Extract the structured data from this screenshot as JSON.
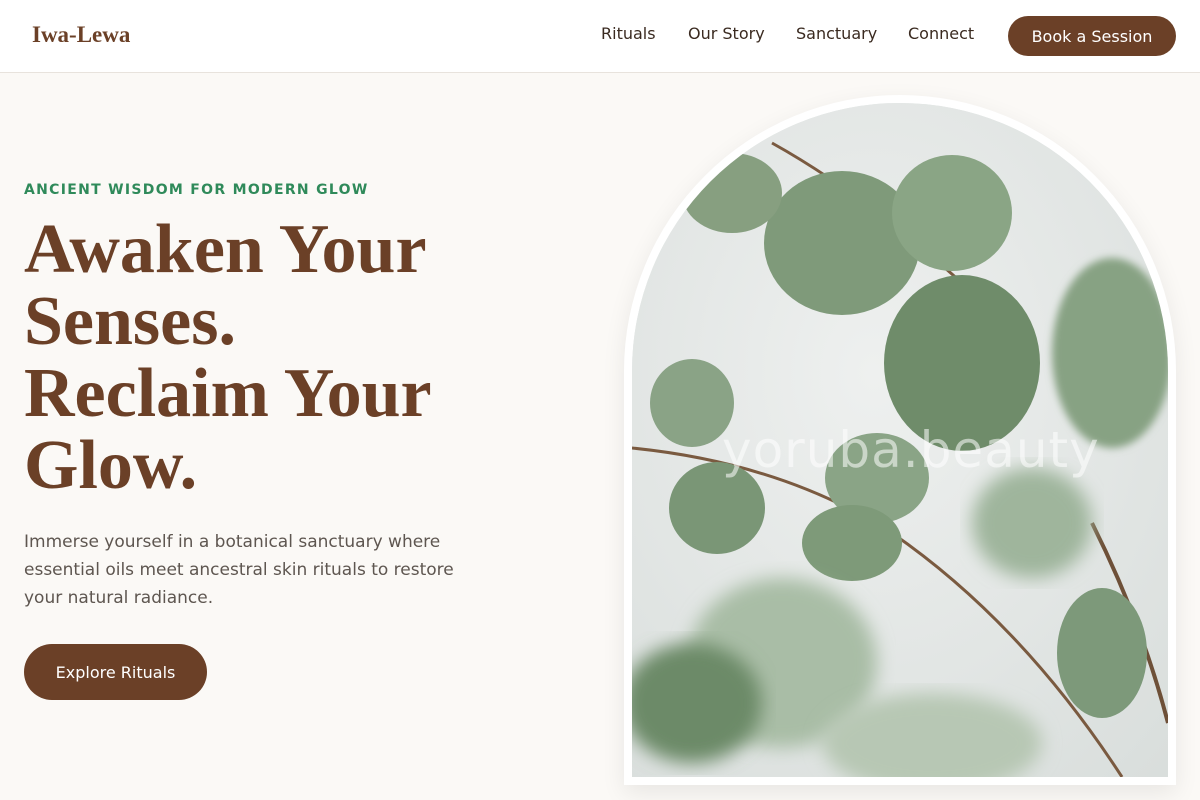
{
  "brand": {
    "name": "Iwa-Lewa"
  },
  "nav": {
    "items": [
      {
        "label": "Rituals"
      },
      {
        "label": "Our Story"
      },
      {
        "label": "Sanctuary"
      },
      {
        "label": "Connect"
      }
    ],
    "cta": "Book a Session"
  },
  "hero": {
    "eyebrow": "ANCIENT WISDOM FOR MODERN GLOW",
    "headline_lines": [
      "Awaken Your",
      "Senses.",
      "Reclaim Your",
      "Glow."
    ],
    "lead": "Immerse yourself in a botanical sanctuary where essential oils meet ancestral skin rituals to restore your natural radiance.",
    "cta": "Explore Rituals",
    "image": {
      "subject": "eucalyptus-leaves",
      "watermark": "yoruba.beauty"
    }
  },
  "colors": {
    "brand": "#6b4027",
    "accent": "#2f8a5a",
    "background": "#fbf9f6"
  }
}
